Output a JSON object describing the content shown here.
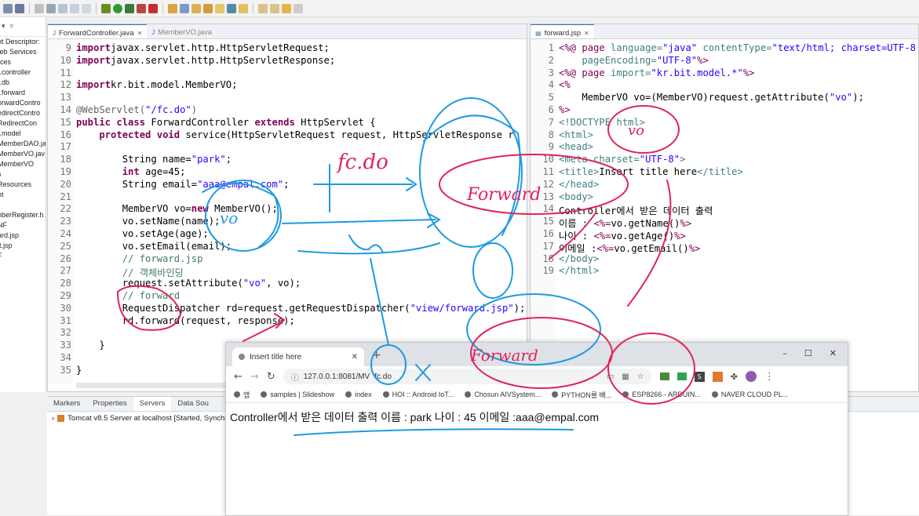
{
  "explorer": {
    "items": [
      "nt Descriptor:",
      "/eb Services",
      "rces",
      "",
      "t.controller",
      "t.db",
      "t.forward",
      "orwardContro",
      "edirectContro",
      "RedirectCon",
      "t.model",
      "MemberDAO.ja",
      "MemberVO.jav",
      "MemberVO",
      "s",
      "Resources",
      "",
      "nt",
      "r",
      "",
      "nberRegister.h",
      "NF",
      "",
      "ard.jsp",
      "lt.jsp",
      "F"
    ]
  },
  "left_editor": {
    "tabs": [
      {
        "label": "ForwardController.java",
        "active": true
      },
      {
        "label": "MemberVO.java",
        "active": false
      }
    ],
    "lines": [
      {
        "n": "9",
        "segments": [
          [
            "kw",
            "import"
          ],
          [
            "",
            "javax.servlet.http.HttpServletRequest;"
          ]
        ]
      },
      {
        "n": "10",
        "segments": [
          [
            "kw",
            "import"
          ],
          [
            "",
            "javax.servlet.http.HttpServletResponse;"
          ]
        ]
      },
      {
        "n": "11",
        "segments": []
      },
      {
        "n": "12",
        "segments": [
          [
            "kw",
            "import"
          ],
          [
            "",
            "kr.bit.model.MemberVO;"
          ]
        ]
      },
      {
        "n": "13",
        "segments": []
      },
      {
        "n": "14",
        "segments": [
          [
            "ann",
            "@WebServlet("
          ],
          [
            "str",
            "\"/fc.do\""
          ],
          [
            "ann",
            ")"
          ]
        ]
      },
      {
        "n": "15",
        "segments": [
          [
            "kw",
            "public class "
          ],
          [
            "",
            "ForwardController "
          ],
          [
            "kw",
            "extends "
          ],
          [
            "",
            "HttpServlet {"
          ]
        ]
      },
      {
        "n": "16",
        "segments": [
          [
            "",
            "    "
          ],
          [
            "kw",
            "protected void "
          ],
          [
            "",
            "service(HttpServletRequest request, HttpServletResponse r"
          ]
        ]
      },
      {
        "n": "17",
        "segments": []
      },
      {
        "n": "18",
        "segments": [
          [
            "",
            "        String name="
          ],
          [
            "str",
            "\"park\""
          ],
          [
            "",
            ";"
          ]
        ]
      },
      {
        "n": "19",
        "segments": [
          [
            "",
            "        "
          ],
          [
            "kw",
            "int "
          ],
          [
            "",
            "age=45;"
          ]
        ]
      },
      {
        "n": "20",
        "segments": [
          [
            "",
            "        String email="
          ],
          [
            "str",
            "\"aaa@empal.com\""
          ],
          [
            "",
            ";"
          ]
        ]
      },
      {
        "n": "21",
        "segments": []
      },
      {
        "n": "22",
        "segments": [
          [
            "",
            "        MemberVO vo="
          ],
          [
            "kw",
            "new "
          ],
          [
            "",
            "MemberVO();"
          ]
        ]
      },
      {
        "n": "23",
        "segments": [
          [
            "",
            "        vo.setName(name);"
          ]
        ]
      },
      {
        "n": "24",
        "segments": [
          [
            "",
            "        vo.setAge(age);"
          ]
        ]
      },
      {
        "n": "25",
        "segments": [
          [
            "",
            "        vo.setEmail(email);"
          ]
        ]
      },
      {
        "n": "26",
        "segments": [
          [
            "cm",
            "        // forward.jsp"
          ]
        ]
      },
      {
        "n": "27",
        "segments": [
          [
            "cm",
            "        // 객체바인딩"
          ]
        ]
      },
      {
        "n": "28",
        "segments": [
          [
            "",
            "        request.setAttribute("
          ],
          [
            "str",
            "\"vo\""
          ],
          [
            "",
            ", vo);"
          ]
        ]
      },
      {
        "n": "29",
        "segments": [
          [
            "cm",
            "        // forward"
          ]
        ]
      },
      {
        "n": "30",
        "segments": [
          [
            "",
            "        RequestDispatcher rd=request.getRequestDispatcher("
          ],
          [
            "str",
            "\"view/forward.jsp\""
          ],
          [
            "",
            ");"
          ]
        ]
      },
      {
        "n": "31",
        "segments": [
          [
            "",
            "        rd.forward(request, response);"
          ]
        ]
      },
      {
        "n": "32",
        "segments": []
      },
      {
        "n": "33",
        "segments": [
          [
            "",
            "    }"
          ]
        ]
      },
      {
        "n": "34",
        "segments": []
      },
      {
        "n": "35",
        "segments": [
          [
            "",
            "}"
          ]
        ]
      }
    ]
  },
  "right_editor": {
    "tab": "forward.jsp",
    "lines": [
      {
        "n": "1",
        "segments": [
          [
            "jspkw",
            "<%@ "
          ],
          [
            "jspkw",
            "page "
          ],
          [
            "tag",
            "language="
          ],
          [
            "str",
            "\"java\" "
          ],
          [
            "tag",
            "contentType="
          ],
          [
            "str",
            "\"text/html; charset=UTF-8"
          ]
        ]
      },
      {
        "n": "2",
        "segments": [
          [
            "tag",
            "    pageEncoding="
          ],
          [
            "str",
            "\"UTF-8\""
          ],
          [
            "jspkw",
            "%>"
          ]
        ]
      },
      {
        "n": "3",
        "segments": [
          [
            "jspkw",
            "<%@ "
          ],
          [
            "jspkw",
            "page "
          ],
          [
            "tag",
            "import="
          ],
          [
            "str",
            "\"kr.bit.model.*\""
          ],
          [
            "jspkw",
            "%>"
          ]
        ]
      },
      {
        "n": "4",
        "segments": [
          [
            "jspkw",
            "<%"
          ]
        ]
      },
      {
        "n": "5",
        "segments": [
          [
            "",
            "    MemberVO vo=(MemberVO)request.getAttribute("
          ],
          [
            "str",
            "\"vo\""
          ],
          [
            "",
            ");"
          ]
        ]
      },
      {
        "n": "6",
        "segments": [
          [
            "jspkw",
            "%>"
          ]
        ]
      },
      {
        "n": "7",
        "segments": [
          [
            "tag",
            "<!DOCTYPE html>"
          ]
        ]
      },
      {
        "n": "8",
        "segments": [
          [
            "tag",
            "<html>"
          ]
        ]
      },
      {
        "n": "9",
        "segments": [
          [
            "tag",
            "<head>"
          ]
        ]
      },
      {
        "n": "10",
        "segments": [
          [
            "tag",
            "<meta "
          ],
          [
            "tag",
            "charset="
          ],
          [
            "str",
            "\"UTF-8\""
          ],
          [
            "tag",
            ">"
          ]
        ]
      },
      {
        "n": "11",
        "segments": [
          [
            "tag",
            "<title>"
          ],
          [
            "",
            "Insert title here"
          ],
          [
            "tag",
            "</title>"
          ]
        ]
      },
      {
        "n": "12",
        "segments": [
          [
            "tag",
            "</head>"
          ]
        ]
      },
      {
        "n": "13",
        "segments": [
          [
            "tag",
            "<body>"
          ]
        ]
      },
      {
        "n": "14",
        "segments": [
          [
            "",
            "Controller에서 받은 데이터 출력"
          ]
        ]
      },
      {
        "n": "15",
        "segments": [
          [
            "",
            "이름 : "
          ],
          [
            "jspkw",
            "<%="
          ],
          [
            "",
            "vo.getName()"
          ],
          [
            "jspkw",
            "%>"
          ]
        ]
      },
      {
        "n": "16",
        "segments": [
          [
            "",
            "나이 : "
          ],
          [
            "jspkw",
            "<%="
          ],
          [
            "",
            "vo.getAge()"
          ],
          [
            "jspkw",
            "%>"
          ]
        ]
      },
      {
        "n": "17",
        "segments": [
          [
            "",
            "이메일 :"
          ],
          [
            "jspkw",
            "<%="
          ],
          [
            "",
            "vo.getEmail()"
          ],
          [
            "jspkw",
            "%>"
          ]
        ]
      },
      {
        "n": "18",
        "segments": [
          [
            "tag",
            "</body>"
          ]
        ]
      },
      {
        "n": "19",
        "segments": [
          [
            "tag",
            "</html>"
          ]
        ]
      }
    ]
  },
  "bottom_panel": {
    "tabs": [
      "Markers",
      "Properties",
      "Servers",
      "Data Sou"
    ],
    "active_tab": "Servers",
    "server_row": "Tomcat v8.5 Server at localhost  [Started, Synchro"
  },
  "browser": {
    "tab_title": "Insert title here",
    "url": "127.0.0.1:8081/MV",
    "url_tail": "fc.do",
    "bookmarks": [
      "앱",
      "samples | Slideshow",
      "index",
      "HOI :: Android IoT...",
      "Chosun AIVSystem...",
      "PYTHON를 배...",
      "ESP8266 - ARDUIN...",
      "NAVER CLOUD PL..."
    ],
    "content": "Controller에서 받은 데이터 출력 이름 : park 나이 : 45 이메일 :aaa@empal.com"
  },
  "annotations": {
    "labels": [
      "fc.do",
      "Forward",
      "vo",
      "vo",
      "Forward"
    ]
  },
  "colors": {
    "ink_blue": "#1e9be0",
    "ink_red": "#e0245a"
  }
}
